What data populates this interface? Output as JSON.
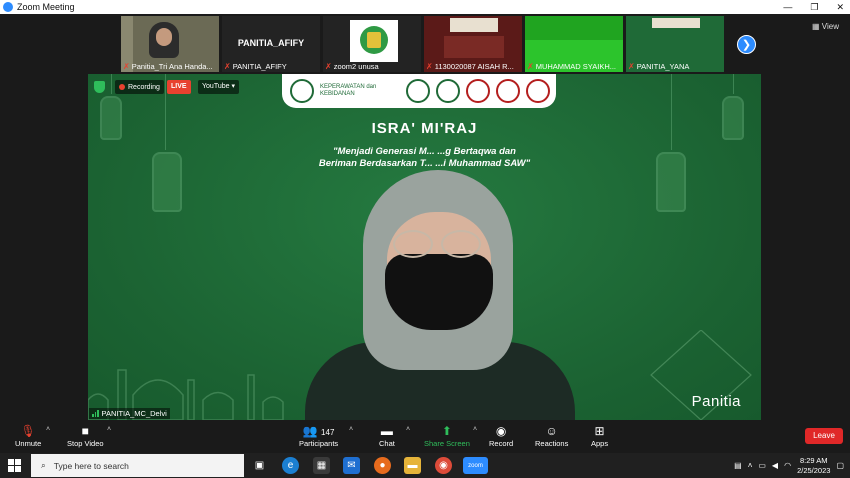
{
  "window": {
    "title": "Zoom Meeting",
    "controls": [
      "—",
      "❐",
      "✕"
    ]
  },
  "gallery": {
    "tiles": [
      {
        "name": "Panitia_Tri Ana Handa...",
        "type": "video"
      },
      {
        "name": "PANITIA_AFIFY",
        "big_name": "PANITIA_AFIFY",
        "type": "name"
      },
      {
        "name": "zoom2 unusa",
        "type": "logo"
      },
      {
        "name": "1130020087 AISAH R...",
        "type": "video"
      },
      {
        "name": "MUHAMMAD SYAIKH...",
        "type": "green"
      },
      {
        "name": "PANITIA_YANA",
        "type": "video"
      }
    ],
    "view_label": "View"
  },
  "stage": {
    "recording_label": "Recording",
    "live_label": "LIVE",
    "stream_label": "YouTube",
    "event_title": "ISRA' MI'RAJ",
    "theme_line1": "\"Menjadi Generasi M... ...g Bertaqwa dan",
    "theme_line2": "Beriman Berdasarkan T... ...i Muhammad SAW\"",
    "faculty_label": "KEPERAWATAN dan KEBIDANAN",
    "overlay_label": "Panitia",
    "speaker_name": "PANITIA_MC_Delvi"
  },
  "toolbar": {
    "unmute": "Unmute",
    "stop_video": "Stop Video",
    "participants": "Participants",
    "participant_count": "147",
    "chat": "Chat",
    "share_screen": "Share Screen",
    "record": "Record",
    "reactions": "Reactions",
    "apps": "Apps",
    "leave": "Leave"
  },
  "taskbar": {
    "search_placeholder": "Type here to search",
    "time": "8:29 AM",
    "date": "2/25/2023"
  },
  "colors": {
    "accent": "#2d8cff",
    "stage_green": "#1f6a37",
    "leave_red": "#e02828",
    "share_green": "#2fbd5b"
  }
}
